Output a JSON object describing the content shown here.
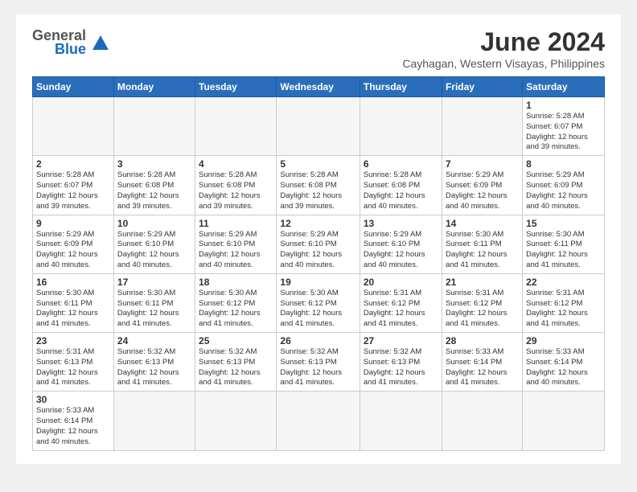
{
  "header": {
    "logo_general": "General",
    "logo_blue": "Blue",
    "month_year": "June 2024",
    "location": "Cayhagan, Western Visayas, Philippines"
  },
  "weekdays": [
    "Sunday",
    "Monday",
    "Tuesday",
    "Wednesday",
    "Thursday",
    "Friday",
    "Saturday"
  ],
  "weeks": [
    [
      {
        "day": "",
        "info": ""
      },
      {
        "day": "",
        "info": ""
      },
      {
        "day": "",
        "info": ""
      },
      {
        "day": "",
        "info": ""
      },
      {
        "day": "",
        "info": ""
      },
      {
        "day": "",
        "info": ""
      },
      {
        "day": "1",
        "info": "Sunrise: 5:28 AM\nSunset: 6:07 PM\nDaylight: 12 hours and 39 minutes."
      }
    ],
    [
      {
        "day": "2",
        "info": "Sunrise: 5:28 AM\nSunset: 6:07 PM\nDaylight: 12 hours and 39 minutes."
      },
      {
        "day": "3",
        "info": "Sunrise: 5:28 AM\nSunset: 6:08 PM\nDaylight: 12 hours and 39 minutes."
      },
      {
        "day": "4",
        "info": "Sunrise: 5:28 AM\nSunset: 6:08 PM\nDaylight: 12 hours and 39 minutes."
      },
      {
        "day": "5",
        "info": "Sunrise: 5:28 AM\nSunset: 6:08 PM\nDaylight: 12 hours and 39 minutes."
      },
      {
        "day": "6",
        "info": "Sunrise: 5:28 AM\nSunset: 6:08 PM\nDaylight: 12 hours and 40 minutes."
      },
      {
        "day": "7",
        "info": "Sunrise: 5:29 AM\nSunset: 6:09 PM\nDaylight: 12 hours and 40 minutes."
      },
      {
        "day": "8",
        "info": "Sunrise: 5:29 AM\nSunset: 6:09 PM\nDaylight: 12 hours and 40 minutes."
      }
    ],
    [
      {
        "day": "9",
        "info": "Sunrise: 5:29 AM\nSunset: 6:09 PM\nDaylight: 12 hours and 40 minutes."
      },
      {
        "day": "10",
        "info": "Sunrise: 5:29 AM\nSunset: 6:10 PM\nDaylight: 12 hours and 40 minutes."
      },
      {
        "day": "11",
        "info": "Sunrise: 5:29 AM\nSunset: 6:10 PM\nDaylight: 12 hours and 40 minutes."
      },
      {
        "day": "12",
        "info": "Sunrise: 5:29 AM\nSunset: 6:10 PM\nDaylight: 12 hours and 40 minutes."
      },
      {
        "day": "13",
        "info": "Sunrise: 5:29 AM\nSunset: 6:10 PM\nDaylight: 12 hours and 40 minutes."
      },
      {
        "day": "14",
        "info": "Sunrise: 5:30 AM\nSunset: 6:11 PM\nDaylight: 12 hours and 41 minutes."
      },
      {
        "day": "15",
        "info": "Sunrise: 5:30 AM\nSunset: 6:11 PM\nDaylight: 12 hours and 41 minutes."
      }
    ],
    [
      {
        "day": "16",
        "info": "Sunrise: 5:30 AM\nSunset: 6:11 PM\nDaylight: 12 hours and 41 minutes."
      },
      {
        "day": "17",
        "info": "Sunrise: 5:30 AM\nSunset: 6:11 PM\nDaylight: 12 hours and 41 minutes."
      },
      {
        "day": "18",
        "info": "Sunrise: 5:30 AM\nSunset: 6:12 PM\nDaylight: 12 hours and 41 minutes."
      },
      {
        "day": "19",
        "info": "Sunrise: 5:30 AM\nSunset: 6:12 PM\nDaylight: 12 hours and 41 minutes."
      },
      {
        "day": "20",
        "info": "Sunrise: 5:31 AM\nSunset: 6:12 PM\nDaylight: 12 hours and 41 minutes."
      },
      {
        "day": "21",
        "info": "Sunrise: 5:31 AM\nSunset: 6:12 PM\nDaylight: 12 hours and 41 minutes."
      },
      {
        "day": "22",
        "info": "Sunrise: 5:31 AM\nSunset: 6:12 PM\nDaylight: 12 hours and 41 minutes."
      }
    ],
    [
      {
        "day": "23",
        "info": "Sunrise: 5:31 AM\nSunset: 6:13 PM\nDaylight: 12 hours and 41 minutes."
      },
      {
        "day": "24",
        "info": "Sunrise: 5:32 AM\nSunset: 6:13 PM\nDaylight: 12 hours and 41 minutes."
      },
      {
        "day": "25",
        "info": "Sunrise: 5:32 AM\nSunset: 6:13 PM\nDaylight: 12 hours and 41 minutes."
      },
      {
        "day": "26",
        "info": "Sunrise: 5:32 AM\nSunset: 6:13 PM\nDaylight: 12 hours and 41 minutes."
      },
      {
        "day": "27",
        "info": "Sunrise: 5:32 AM\nSunset: 6:13 PM\nDaylight: 12 hours and 41 minutes."
      },
      {
        "day": "28",
        "info": "Sunrise: 5:33 AM\nSunset: 6:14 PM\nDaylight: 12 hours and 41 minutes."
      },
      {
        "day": "29",
        "info": "Sunrise: 5:33 AM\nSunset: 6:14 PM\nDaylight: 12 hours and 40 minutes."
      }
    ],
    [
      {
        "day": "30",
        "info": "Sunrise: 5:33 AM\nSunset: 6:14 PM\nDaylight: 12 hours and 40 minutes."
      },
      {
        "day": "",
        "info": ""
      },
      {
        "day": "",
        "info": ""
      },
      {
        "day": "",
        "info": ""
      },
      {
        "day": "",
        "info": ""
      },
      {
        "day": "",
        "info": ""
      },
      {
        "day": "",
        "info": ""
      }
    ]
  ]
}
